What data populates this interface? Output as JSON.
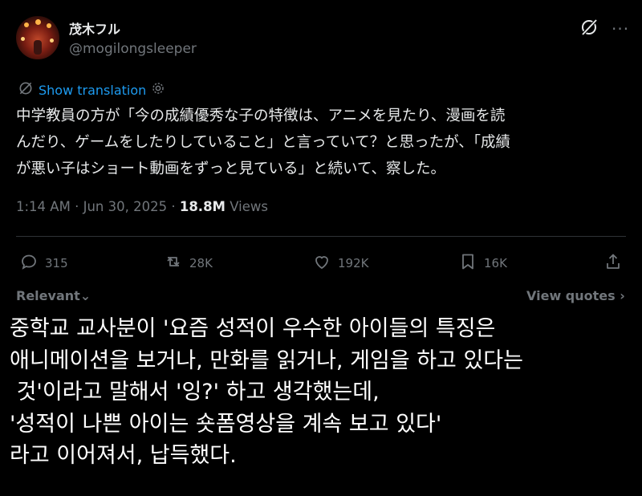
{
  "author": {
    "display_name": "茂木フル",
    "handle": "@mogilongsleeper"
  },
  "header_icons": [
    "grok-icon",
    "more-icon"
  ],
  "more_glyph": "···",
  "translation": {
    "label": "Show translation",
    "icon": "translate-icon"
  },
  "tweet": {
    "lines": [
      "中学教員の方が「今の成績優秀な子の特徴は、アニメを見たり、漫画を読",
      "んだり、ゲームをしたりしていること」と言っていて？と思ったが、「成績",
      "が悪い子はショート動画をずっと見ている」と続いて、察した。"
    ]
  },
  "meta": {
    "time": "1:14 AM",
    "date": "Jun 30, 2025",
    "views_count": "18.8M",
    "views_label": "Views",
    "separator": "·"
  },
  "actions": [
    {
      "icon": "reply-icon",
      "count": "315"
    },
    {
      "icon": "retweet-icon",
      "count": "28K"
    },
    {
      "icon": "like-icon",
      "count": "192K"
    },
    {
      "icon": "bookmark-icon",
      "count": "16K"
    },
    {
      "icon": "share-icon",
      "count": ""
    }
  ],
  "replies_bar": {
    "sort_label": "Relevant",
    "sort_chevron": "⌄",
    "view_quotes_label": "View quotes",
    "view_quotes_chevron": "›"
  },
  "overlay_translation": {
    "lines": [
      "중학교 교사분이 '요즘 성적이 우수한 아이들의 특징은",
      "애니메이션을 보거나, 만화를 읽거나, 게임을 하고 있다는",
      " 것'이라고 말해서 '잉?' 하고 생각했는데,",
      "'성적이 나쁜 아이는 숏폼영상을 계속 보고 있다'",
      "라고 이어져서, 납득했다."
    ]
  },
  "colors": {
    "background": "#000000",
    "text": "#e7e9ea",
    "muted": "#71767b",
    "link": "#1d9bf0",
    "divider": "#2f3336"
  }
}
